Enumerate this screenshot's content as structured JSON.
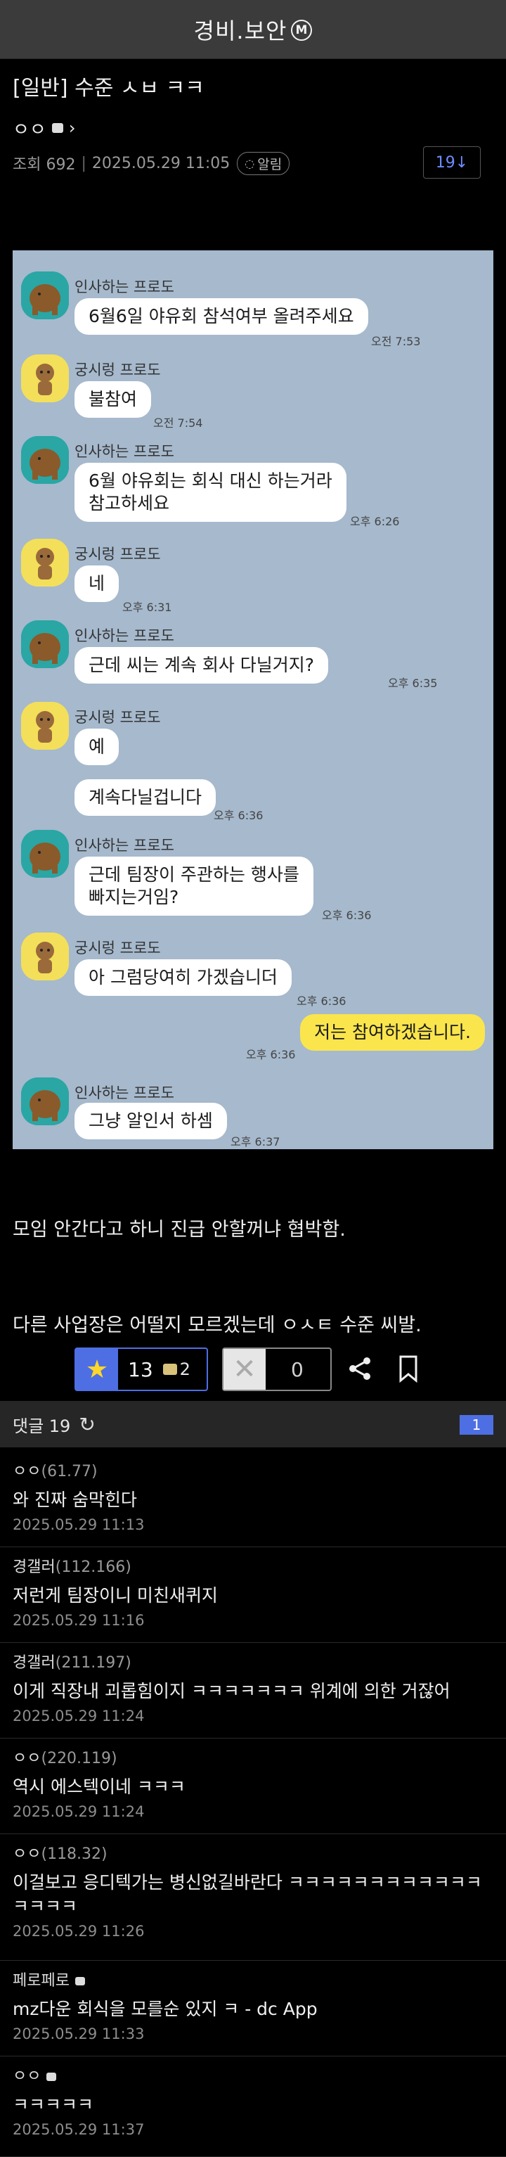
{
  "app": {
    "title": "경비.보안",
    "badge": "M"
  },
  "post": {
    "title": "[일반] 수준 ㅅㅂ ㅋㅋ",
    "author": "ㅇㅇ",
    "views_label": "조회 692",
    "datetime": "2025.05.29 11:05",
    "alarm_label": "알림",
    "reply_count_btn": "19↓",
    "body_lines": [
      "모임 안간다고 하니 진급 안할꺼냐 협박함.",
      "다른 사업장은 어떨지 모르겠는데 ㅇㅅㅌ 수준 씨발."
    ]
  },
  "chat": {
    "messages": [
      {
        "sender": "인사하는 프로도",
        "text": "6월6일 야유회 참석여부 올려주세요",
        "time": "오전 7:53",
        "side": "left",
        "avatar": "teal"
      },
      {
        "sender": "궁시렁 프로도",
        "text": "불참여",
        "time": "오전 7:54",
        "side": "left",
        "avatar": "yellow"
      },
      {
        "sender": "인사하는 프로도",
        "text": "6월 야유회는 회식 대신 하는거라\n참고하세요",
        "time": "오후 6:26",
        "side": "left",
        "avatar": "teal"
      },
      {
        "sender": "궁시렁 프로도",
        "text": "네",
        "time": "오후 6:31",
        "side": "left",
        "avatar": "yellow"
      },
      {
        "sender": "인사하는 프로도",
        "text": "근데      씨는 계속 회사 다닐거지?",
        "time": "오후 6:35",
        "side": "left",
        "avatar": "teal"
      },
      {
        "sender": "궁시렁 프로도",
        "text": "예",
        "time": "",
        "side": "left",
        "avatar": "yellow"
      },
      {
        "sender": "",
        "text": "계속다닐겁니다",
        "time": "오후 6:36",
        "side": "left",
        "avatar": ""
      },
      {
        "sender": "인사하는 프로도",
        "text": "근데 팀장이 주관하는 행사를\n빠지는거임?",
        "time": "오후 6:36",
        "side": "left",
        "avatar": "teal"
      },
      {
        "sender": "궁시렁 프로도",
        "text": "아 그럼당여히 가겠습니더",
        "time": "오후 6:36",
        "side": "left",
        "avatar": "yellow"
      },
      {
        "sender": "",
        "text": "저는 참여하겠습니다.",
        "time": "오후 6:36",
        "side": "right",
        "avatar": ""
      },
      {
        "sender": "인사하는 프로도",
        "text": "그냥 알인서 하셈",
        "time": "오후 6:37",
        "side": "left",
        "avatar": "teal"
      }
    ]
  },
  "actions": {
    "recommend": "13",
    "fix_count": "2",
    "not_recommend": "0"
  },
  "comments_header": {
    "label": "댓글 19",
    "page": "1"
  },
  "comments": [
    {
      "author": "ㅇㅇ",
      "ip": "(61.77)",
      "text": "와 진짜 숨막힌다",
      "date": "2025.05.29 11:13"
    },
    {
      "author": "경갤러",
      "ip": "(112.166)",
      "text": "저런게 팀장이니 미친새퀴지",
      "date": "2025.05.29 11:16"
    },
    {
      "author": "경갤러",
      "ip": "(211.197)",
      "text": "이게 직장내 괴롭힘이지 ㅋㅋㅋㅋㅋㅋㅋ 위계에 의한 거잖어",
      "date": "2025.05.29 11:24"
    },
    {
      "author": "ㅇㅇ",
      "ip": "(220.119)",
      "text": "역시 에스텍이네 ㅋㅋㅋ",
      "date": "2025.05.29 11:24"
    },
    {
      "author": "ㅇㅇ",
      "ip": "(118.32)",
      "text": "이걸보고 응디텍가는 병신없길바란다 ㅋㅋㅋㅋㅋㅋㅋㅋㅋㅋㅋㅋㅋㅋㅋㅋ",
      "date": "2025.05.29 11:26"
    },
    {
      "author": "페로페로",
      "ip": "",
      "text": "mz다운 회식을 모를순 있지 ㅋ - dc App",
      "date": "2025.05.29 11:33"
    },
    {
      "author": "ㅇㅇ",
      "ip": "",
      "text": "ㅋㅋㅋㅋㅋ",
      "date": "2025.05.29 11:37"
    }
  ]
}
